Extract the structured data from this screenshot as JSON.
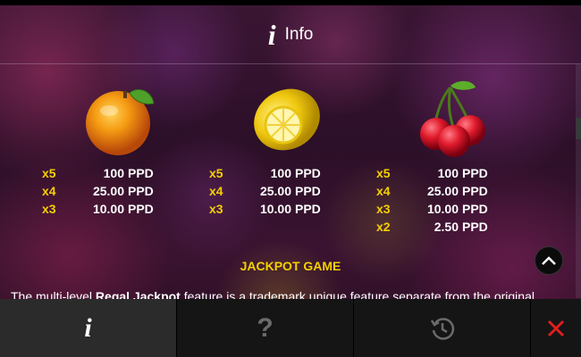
{
  "header": {
    "title": "Info",
    "icon": "info-icon"
  },
  "symbols": [
    {
      "name": "orange",
      "icon": "orange-icon",
      "pays": [
        {
          "mult": "x5",
          "value": "100",
          "unit": "PPD"
        },
        {
          "mult": "x4",
          "value": "25.00",
          "unit": "PPD"
        },
        {
          "mult": "x3",
          "value": "10.00",
          "unit": "PPD"
        }
      ]
    },
    {
      "name": "lemon",
      "icon": "lemon-icon",
      "pays": [
        {
          "mult": "x5",
          "value": "100",
          "unit": "PPD"
        },
        {
          "mult": "x4",
          "value": "25.00",
          "unit": "PPD"
        },
        {
          "mult": "x3",
          "value": "10.00",
          "unit": "PPD"
        }
      ]
    },
    {
      "name": "cherry",
      "icon": "cherry-icon",
      "pays": [
        {
          "mult": "x5",
          "value": "100",
          "unit": "PPD"
        },
        {
          "mult": "x4",
          "value": "25.00",
          "unit": "PPD"
        },
        {
          "mult": "x3",
          "value": "10.00",
          "unit": "PPD"
        },
        {
          "mult": "x2",
          "value": "2.50",
          "unit": "PPD"
        }
      ]
    }
  ],
  "jackpot": {
    "title": "JACKPOT GAME",
    "desc_prefix": "The multi-level ",
    "desc_bold": "Regal Jackpot",
    "desc_suffix": " feature is a trademark unique feature separate from the original"
  },
  "bottom_bar": {
    "info_icon": "info-icon",
    "help_icon": "question-icon",
    "help_label": "?",
    "history_icon": "history-icon",
    "close_icon": "close-icon"
  },
  "colors": {
    "accent_yellow": "#f5d000",
    "close_red": "#e01e1e"
  }
}
